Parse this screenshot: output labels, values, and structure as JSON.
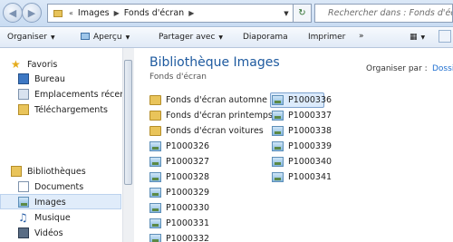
{
  "address": {
    "crumbs": [
      "Images",
      "Fonds d'écran"
    ],
    "overflow": "«"
  },
  "search": {
    "placeholder": "Rechercher dans : Fonds d'écran"
  },
  "toolbar": {
    "organize": "Organiser",
    "preview": "Aperçu",
    "share": "Partager avec",
    "slideshow": "Diaporama",
    "print": "Imprimer",
    "more": "»"
  },
  "nav": {
    "favorites": "Favoris",
    "desktop": "Bureau",
    "recent": "Emplacements récents",
    "downloads": "Téléchargements",
    "libraries": "Bibliothèques",
    "documents": "Documents",
    "images": "Images",
    "music": "Musique",
    "videos": "Vidéos"
  },
  "content": {
    "title": "Bibliothèque Images",
    "subtitle": "Fonds d'écran",
    "arrange_label": "Organiser par :",
    "arrange_value": "Dossi",
    "col1": [
      "Fonds d'écran automne",
      "Fonds d'écran printemps",
      "Fonds d'écran voitures",
      "P1000326",
      "P1000327",
      "P1000328",
      "P1000329",
      "P1000330",
      "P1000331",
      "P1000332"
    ],
    "col2": [
      "P1000336",
      "P1000337",
      "P1000338",
      "P1000339",
      "P1000340",
      "P1000341"
    ]
  }
}
